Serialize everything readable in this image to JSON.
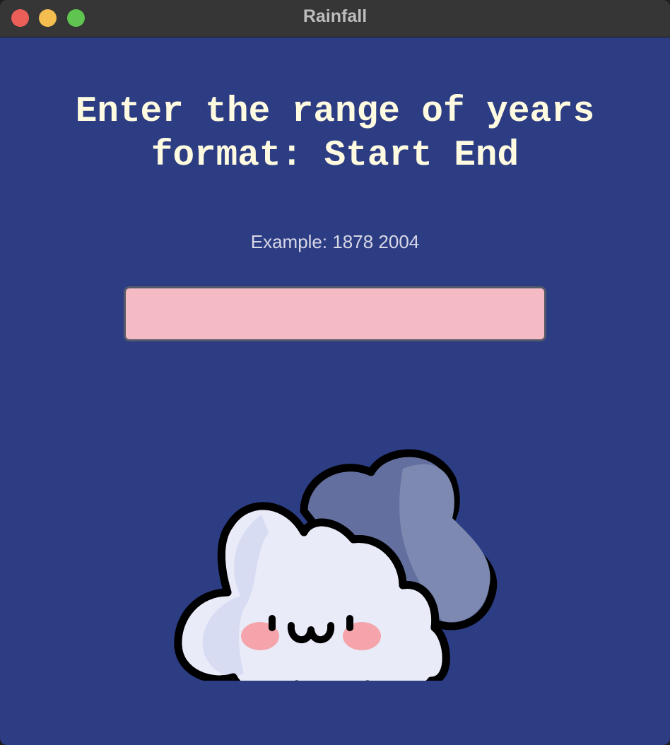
{
  "window": {
    "title": "Rainfall"
  },
  "main": {
    "heading_line1": "Enter the range of years",
    "heading_line2": "format: Start End",
    "example": "Example: 1878 2004",
    "year_input": {
      "value": "",
      "placeholder": ""
    }
  },
  "illustration": {
    "icon": "cute-cloud-icon"
  },
  "colors": {
    "background": "#2d3d84",
    "heading": "#fffbe0",
    "input_fill": "#f4bbc5",
    "titlebar": "#363636"
  }
}
